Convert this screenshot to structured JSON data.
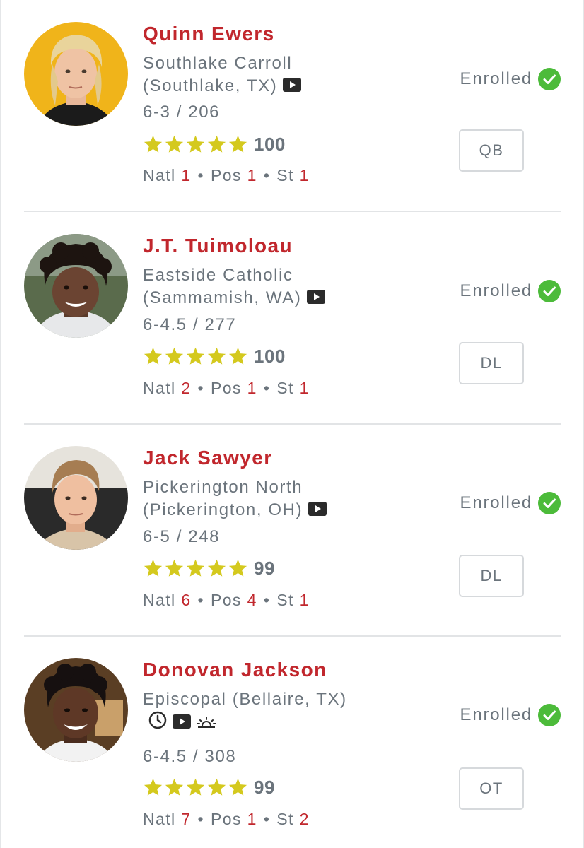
{
  "recruits": [
    {
      "name": "Quinn Ewers",
      "school": "Southlake Carroll (Southlake, TX)",
      "height_weight": "6-3 / 206",
      "stars": 5,
      "rating": "100",
      "rank_labels": {
        "natl": "Natl",
        "pos": "Pos",
        "st": "St"
      },
      "natl_rank": "1",
      "pos_rank": "1",
      "st_rank": "1",
      "status": "Enrolled",
      "position": "QB",
      "icons": [
        "video-icon"
      ]
    },
    {
      "name": "J.T. Tuimoloau",
      "school": "Eastside Catholic (Sammamish, WA)",
      "height_weight": "6-4.5 / 277",
      "stars": 5,
      "rating": "100",
      "rank_labels": {
        "natl": "Natl",
        "pos": "Pos",
        "st": "St"
      },
      "natl_rank": "2",
      "pos_rank": "1",
      "st_rank": "1",
      "status": "Enrolled",
      "position": "DL",
      "icons": [
        "video-icon"
      ]
    },
    {
      "name": "Jack Sawyer",
      "school": "Pickerington North (Pickerington, OH)",
      "height_weight": "6-5 / 248",
      "stars": 5,
      "rating": "99",
      "rank_labels": {
        "natl": "Natl",
        "pos": "Pos",
        "st": "St"
      },
      "natl_rank": "6",
      "pos_rank": "4",
      "st_rank": "1",
      "status": "Enrolled",
      "position": "DL",
      "icons": [
        "video-icon"
      ]
    },
    {
      "name": "Donovan Jackson",
      "school": "Episcopal (Bellaire, TX)",
      "height_weight": "6-4.5 / 308",
      "stars": 5,
      "rating": "99",
      "rank_labels": {
        "natl": "Natl",
        "pos": "Pos",
        "st": "St"
      },
      "natl_rank": "7",
      "pos_rank": "1",
      "st_rank": "2",
      "status": "Enrolled",
      "position": "OT",
      "icons": [
        "clock-icon",
        "video-icon",
        "sunrise-icon"
      ]
    }
  ],
  "colors": {
    "name_red": "#c1272d",
    "text_gray": "#6b747c",
    "star_yellow": "#d4c91e",
    "check_green": "#4cbb3a",
    "divider": "#e2e4e6"
  }
}
